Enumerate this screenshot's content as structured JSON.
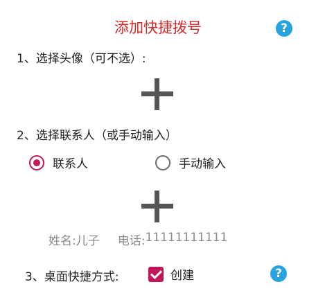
{
  "header": {
    "title": "添加快捷拨号",
    "help_icon": "?"
  },
  "step1": {
    "label": "1、选择头像（可不选）:",
    "add_icon": "plus-icon"
  },
  "step2": {
    "label": "2、选择联系人（或手动输入）",
    "options": [
      {
        "label": "联系人",
        "selected": true
      },
      {
        "label": "手动输入",
        "selected": false
      }
    ],
    "add_icon": "plus-icon",
    "name_label": "姓名:",
    "name_value": "儿子",
    "phone_label": "电话:",
    "phone_value": "11111111111"
  },
  "step3": {
    "label": "3、桌面快捷方式:",
    "checkbox_label": "创建",
    "checked": true,
    "help_icon": "?"
  },
  "colors": {
    "title": "#d12b2b",
    "accent": "#c2185b",
    "help": "#29a3e0",
    "muted_text": "#8a8a8a"
  }
}
